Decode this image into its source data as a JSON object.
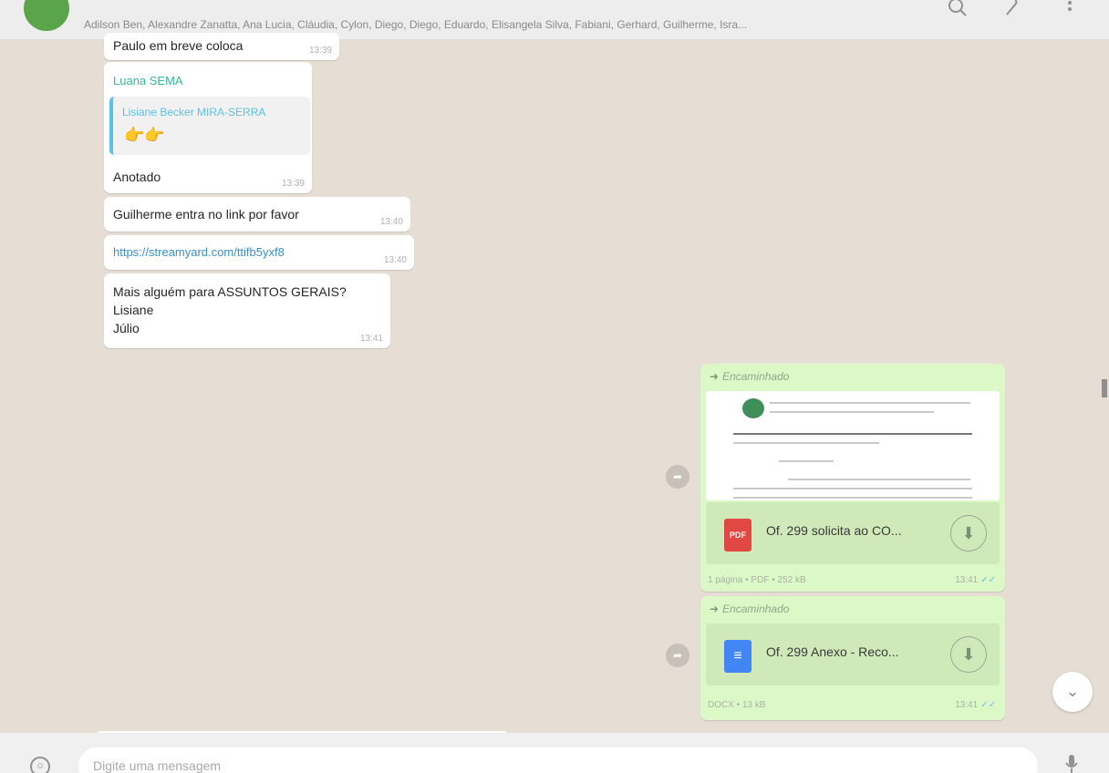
{
  "header": {
    "participants": "Adilson Ben, Alexandre Zanatta, Ana Lucia, Cláudia, Cylon, Diego, Diego, Eduardo, Elisangela Silva, Fabiani, Gerhard, Guilherme, Isra..."
  },
  "messages": {
    "m1": {
      "text": "Paulo em breve coloca",
      "time": "13:39"
    },
    "m2": {
      "sender": "Luana SEMA",
      "quoted_sender": "Lisiane Becker MIRA-SERRA",
      "quoted_text": "👉👉",
      "text": "Anotado",
      "time": "13:39"
    },
    "m3": {
      "text": "Guilherme entra no link por favor",
      "time": "13:40"
    },
    "m4": {
      "text": "https://streamyard.com/ttifb5yxf8",
      "time": "13:40"
    },
    "m5": {
      "line1": "Mais alguém para ASSUNTOS GERAIS?",
      "line2": "Lisiane",
      "line3": "Júlio",
      "time": "13:41"
    },
    "out1": {
      "forwarded": "Encaminhado",
      "file_type": "PDF",
      "file_name": "Of. 299 solicita ao CO...",
      "meta": "1 página • PDF • 252 kB",
      "time": "13:41"
    },
    "out2": {
      "forwarded": "Encaminhado",
      "file_type": "DOCX",
      "file_name": "Of. 299 Anexo - Reco...",
      "meta": "DOCX • 13 kB",
      "time": "13:41"
    }
  },
  "composer": {
    "placeholder": "Digite uma mensagem"
  },
  "colors": {
    "chat_bg": "#e6ded5",
    "outgoing_bubble": "#dcf8c6",
    "sender_name": "#35b79c",
    "quote_accent": "#5ac2e6",
    "link": "#3a8fcd"
  },
  "icons": {
    "search": "search-icon",
    "attach": "paperclip-icon",
    "menu": "menu-dots-icon",
    "emoji": "emoji-icon",
    "mic": "microphone-icon",
    "share": "share-forward-icon",
    "download": "download-icon",
    "scroll_down": "chevron-down-icon"
  }
}
